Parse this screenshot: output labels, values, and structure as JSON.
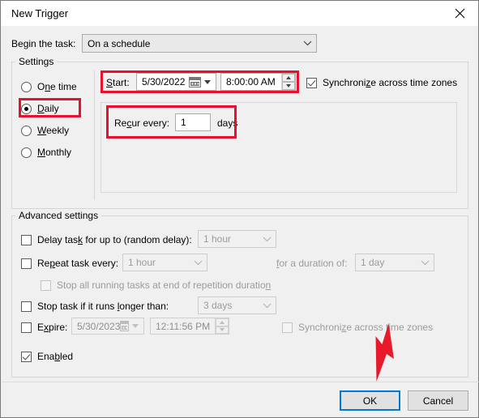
{
  "window": {
    "title": "New Trigger",
    "close_icon": "close-icon"
  },
  "begin": {
    "label": "Begin the task:",
    "value": "On a schedule"
  },
  "settings": {
    "group_title": "Settings",
    "schedule_options": [
      {
        "label": "One time",
        "selected": false
      },
      {
        "label": "Daily",
        "selected": true
      },
      {
        "label": "Weekly",
        "selected": false
      },
      {
        "label": "Monthly",
        "selected": false
      }
    ],
    "start_label": "Start:",
    "start_date": "5/30/2022",
    "start_time": "8:00:00 AM",
    "sync_label": "Synchronize across time zones",
    "sync_checked": true,
    "recur_label": "Recur every:",
    "recur_value": "1",
    "recur_unit": "days"
  },
  "advanced": {
    "group_title": "Advanced settings",
    "delay_label": "Delay task for up to (random delay):",
    "delay_value": "1 hour",
    "delay_checked": false,
    "repeat_label": "Repeat task every:",
    "repeat_value": "1 hour",
    "repeat_checked": false,
    "duration_label": "for a duration of:",
    "duration_value": "1 day",
    "stop_repetition_label": "Stop all running tasks at end of repetition duration",
    "stop_repetition_checked": false,
    "stop_task_label": "Stop task if it runs longer than:",
    "stop_task_value": "3 days",
    "stop_task_checked": false,
    "expire_label": "Expire:",
    "expire_date": "5/30/2023",
    "expire_time": "12:11:56 PM",
    "expire_checked": false,
    "expire_sync_label": "Synchronize across time zones",
    "expire_sync_checked": false,
    "enabled_label": "Enabled",
    "enabled_checked": true
  },
  "footer": {
    "ok_label": "OK",
    "cancel_label": "Cancel"
  },
  "annotations": {
    "highlight_color": "#e8112d",
    "arrow_color": "#e8192b",
    "accent_color": "#0078d7"
  }
}
